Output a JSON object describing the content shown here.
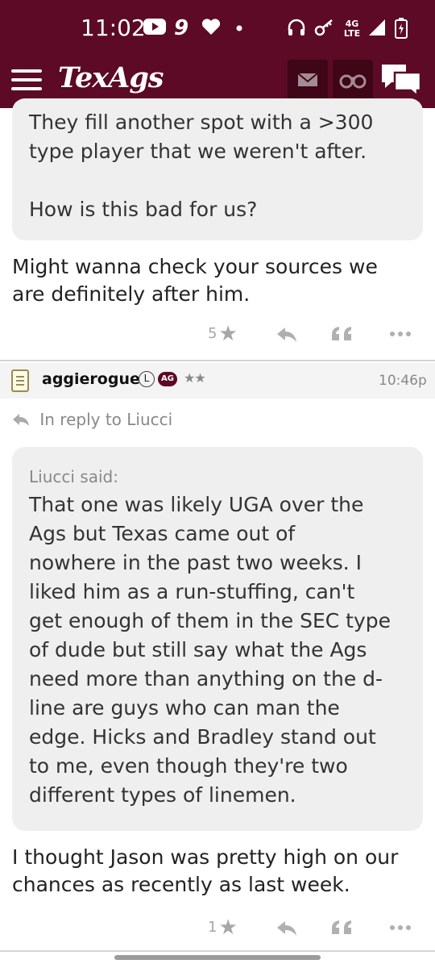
{
  "status_bar": {
    "time": "11:02",
    "notification_count": "9",
    "network": "4G LTE"
  },
  "header": {
    "logo": "TexAgs",
    "icons": [
      "menu-icon",
      "mail-icon",
      "binoculars-icon",
      "chat-icon"
    ]
  },
  "post1": {
    "quote_lines": [
      "They fill another spot with a >300",
      "type player that we weren't after.",
      "",
      "How is this bad for us?"
    ],
    "reply_lines": [
      "Might wanna check your sources we",
      "are definitely after him."
    ],
    "rating_count": "5"
  },
  "post2": {
    "username": "aggierogue",
    "badge_l": "L",
    "badge_ag": "AG",
    "stars": "★★",
    "time": "10:46p",
    "in_reply_to": "In reply to Liucci",
    "quote_author": "Liucci said:",
    "quote_lines": [
      "That one was likely UGA over the",
      "Ags but Texas came out of",
      "nowhere in the past two weeks. I",
      "liked him as a run-stuffing, can't",
      "get enough of them in the SEC type",
      "of dude but still say what the Ags",
      "need more than anything on the d-",
      "line are guys who can man the",
      "edge. Hicks and Bradley stand out",
      "to me, even though they're two",
      "different types of linemen."
    ],
    "reply_lines": [
      "I thought Jason was pretty high on our",
      "chances as recently as last week."
    ],
    "rating_count": "1"
  },
  "colors": {
    "brand_maroon": "#5c0a26",
    "quote_bg": "#efefef",
    "muted": "#a7a7a7"
  }
}
